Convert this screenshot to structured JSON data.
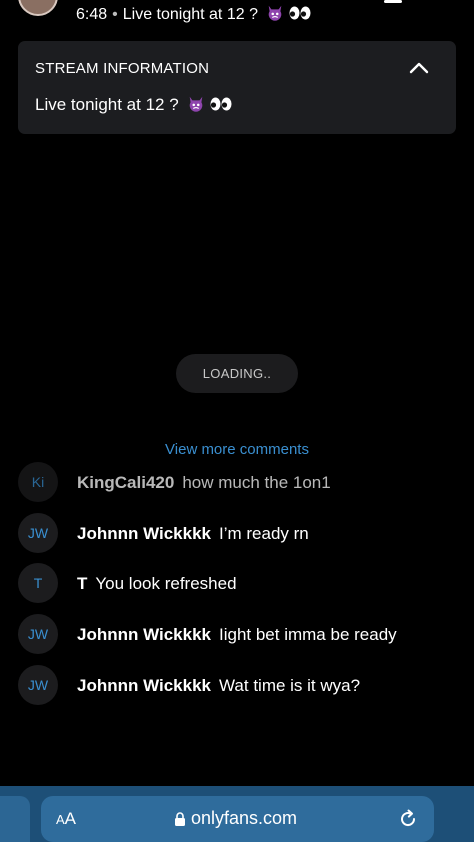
{
  "header": {
    "time": "6:48",
    "separator": "•",
    "stream_title": "Live tonight at 12 ?"
  },
  "stream_info": {
    "title": "STREAM INFORMATION",
    "text": "Live tonight at 12 ?",
    "icons": [
      "devil-emoji-icon",
      "eyes-emoji-icon",
      "chevron-up-icon"
    ]
  },
  "loading": {
    "label": "LOADING.."
  },
  "comments_section": {
    "view_more": "View more comments"
  },
  "comments": [
    {
      "initials": "Ki",
      "name": "KingCali420",
      "message": "how much the 1on1"
    },
    {
      "initials": "JW",
      "name": "Johnnn Wickkkk",
      "message": "I’m ready rn"
    },
    {
      "initials": "T",
      "name": "T",
      "message": "You look refreshed"
    },
    {
      "initials": "JW",
      "name": "Johnnn Wickkkk",
      "message": "Iight bet imma be ready"
    },
    {
      "initials": "JW",
      "name": "Johnnn Wickkkk",
      "message": "Wat time is it wya?"
    }
  ],
  "browser": {
    "text_size_label_small": "A",
    "text_size_label_large": "A",
    "url": "onlyfans.com",
    "icons": [
      "lock-icon",
      "reload-icon"
    ]
  },
  "colors": {
    "background": "#000000",
    "card": "#1c1d20",
    "accent": "#3a8fd0",
    "browser_bar": "#1d4f77"
  }
}
